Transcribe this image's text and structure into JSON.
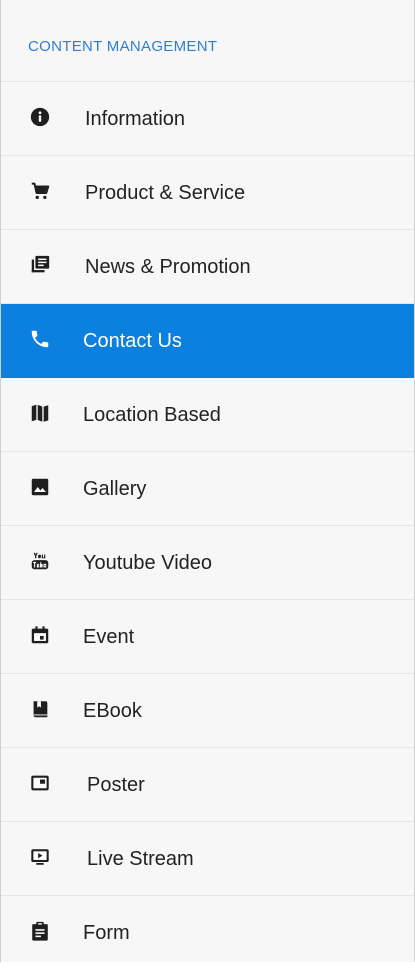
{
  "sidebar": {
    "section_title": "CONTENT MANAGEMENT",
    "items": [
      {
        "label": "Information",
        "icon": "info-icon"
      },
      {
        "label": "Product & Service",
        "icon": "cart-icon"
      },
      {
        "label": "News & Promotion",
        "icon": "news-icon"
      },
      {
        "label": "Contact Us",
        "icon": "phone-icon",
        "active": true
      },
      {
        "label": "Location Based",
        "icon": "map-icon"
      },
      {
        "label": "Gallery",
        "icon": "image-icon"
      },
      {
        "label": "Youtube Video",
        "icon": "youtube-icon"
      },
      {
        "label": "Event",
        "icon": "calendar-icon"
      },
      {
        "label": "EBook",
        "icon": "book-icon"
      },
      {
        "label": "Poster",
        "icon": "poster-icon"
      },
      {
        "label": "Live Stream",
        "icon": "live-stream-icon"
      },
      {
        "label": "Form",
        "icon": "clipboard-icon"
      }
    ]
  },
  "colors": {
    "accent": "#0b80df",
    "section_title": "#2f7fcf",
    "background": "#f7f7f7"
  }
}
